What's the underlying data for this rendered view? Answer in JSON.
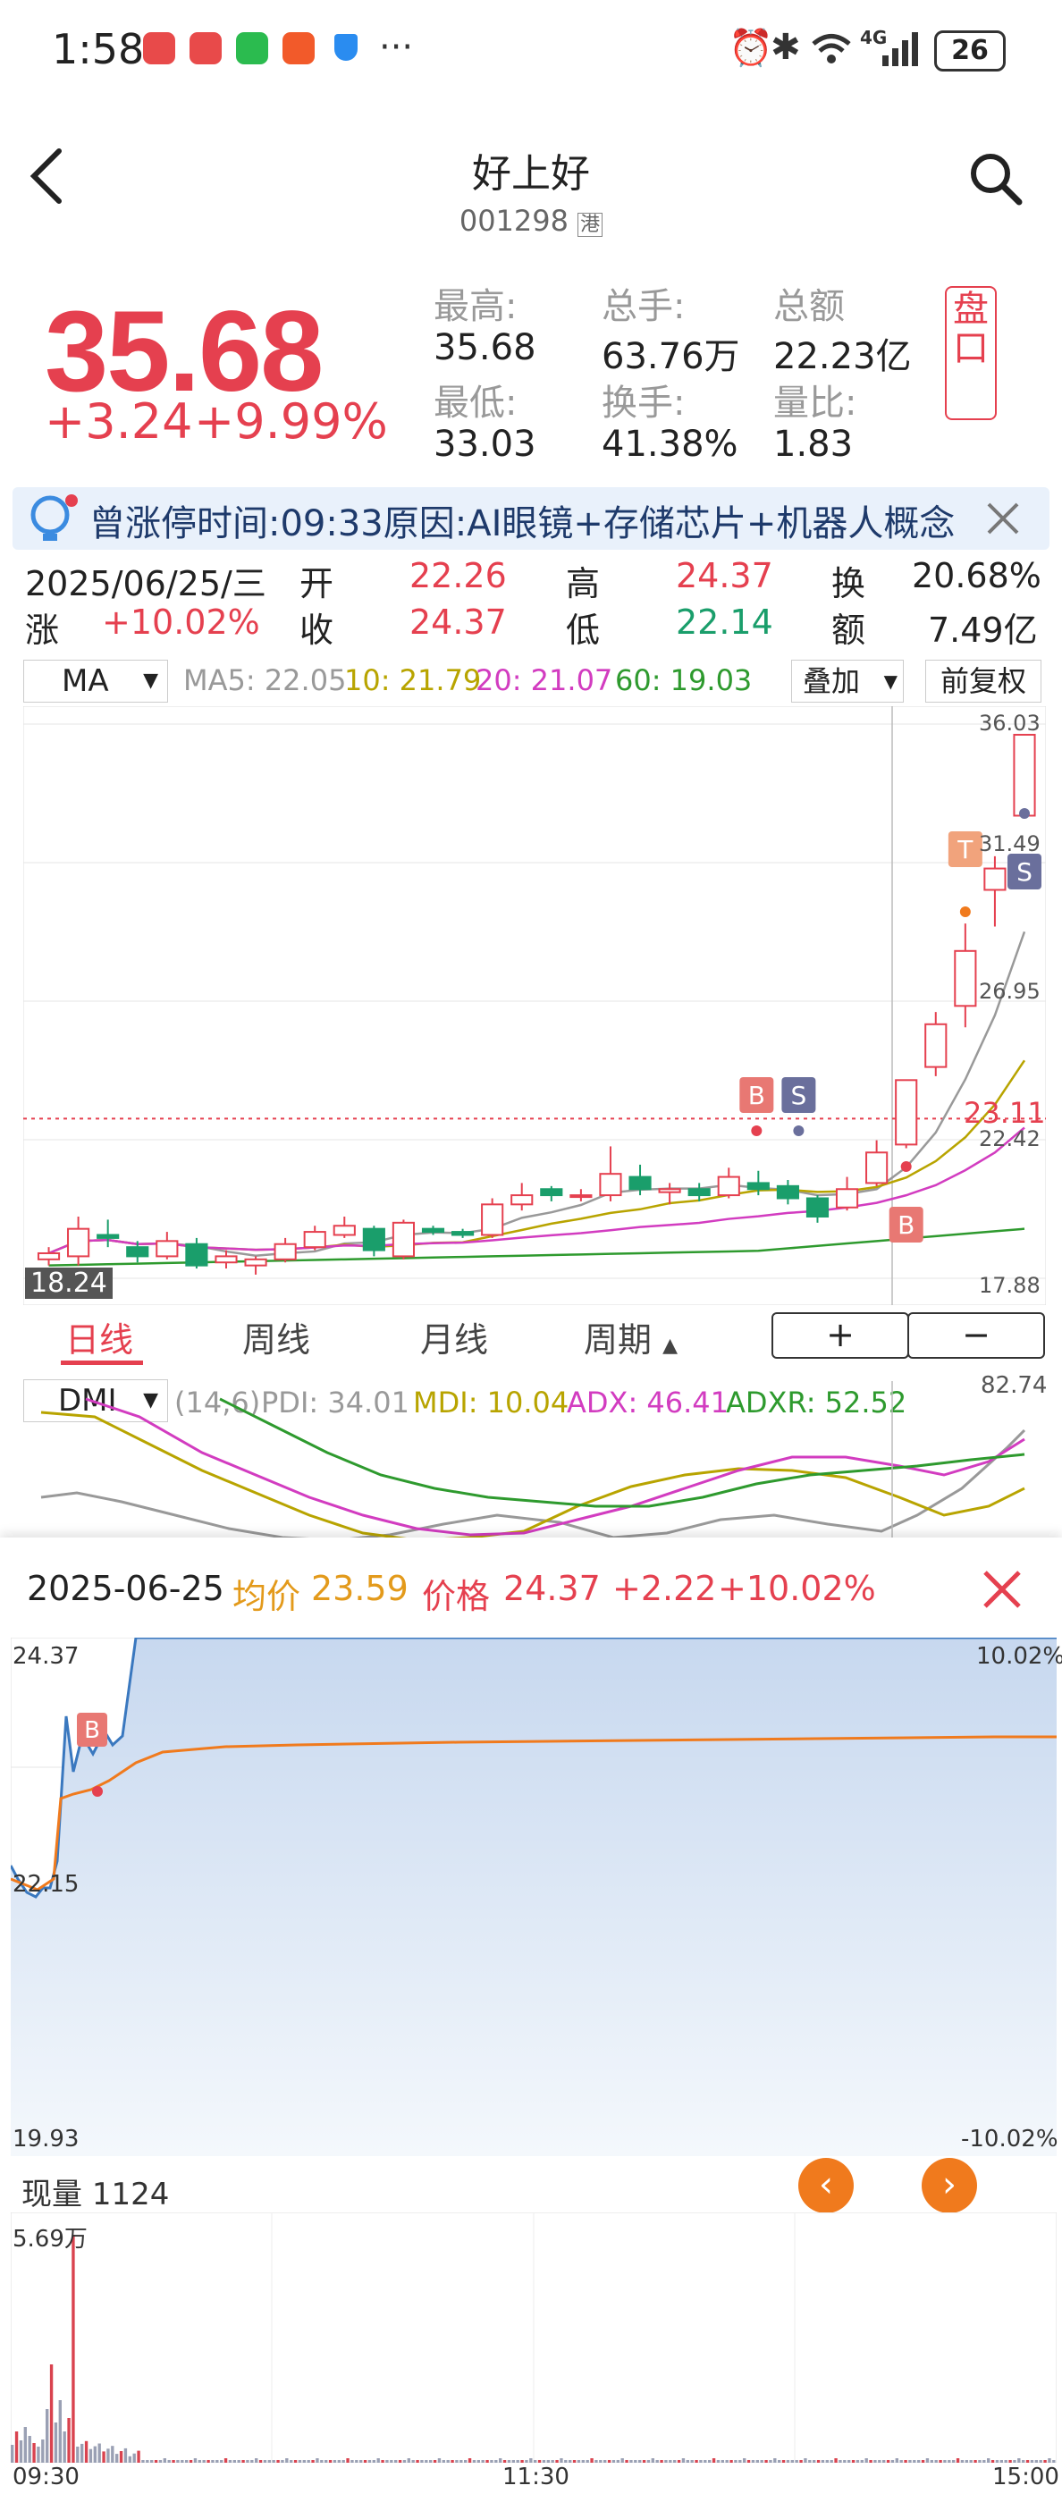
{
  "status_bar": {
    "time": "1:58",
    "network": "4G",
    "battery": "26"
  },
  "nav": {
    "title": "好上好",
    "code": "001298",
    "market_badge": "港"
  },
  "quote": {
    "price": "35.68",
    "change": "+3.24",
    "change_pct": "+9.99%",
    "stats": [
      {
        "label": "最高:",
        "value": "35.68"
      },
      {
        "label": "总手:",
        "value": "63.76万"
      },
      {
        "label": "总额",
        "value": "22.23亿"
      },
      {
        "label": "最低:",
        "value": "33.03"
      },
      {
        "label": "换手:",
        "value": "41.38%"
      },
      {
        "label": "量比:",
        "value": "1.83"
      }
    ],
    "pankou_button": "盘口"
  },
  "news": {
    "text": "曾涨停时间:09:33原因:AI眼镜+存储芯片+机器人概念"
  },
  "day_info": {
    "date": "2025/06/25/三",
    "open_label": "开",
    "open": "22.26",
    "high_label": "高",
    "high": "24.37",
    "turnover_label": "换",
    "turnover": "20.68%",
    "change_label": "涨",
    "change_pct": "+10.02%",
    "close_label": "收",
    "close": "24.37",
    "low_label": "低",
    "low": "22.14",
    "amount_label": "额",
    "amount": "7.49亿"
  },
  "kline": {
    "indicator_select": "MA",
    "ma_legend": [
      {
        "label": "MA5: 22.05",
        "color": "#999999"
      },
      {
        "label": "10: 21.79",
        "color": "#b8a400"
      },
      {
        "label": "20: 21.07",
        "color": "#d23cc0"
      },
      {
        "label": "60: 19.03",
        "color": "#2e9a2e"
      }
    ],
    "overlay_button": "叠加",
    "adjust_button": "前复权",
    "y_labels": [
      "36.03",
      "31.49",
      "26.95",
      "22.42",
      "17.88"
    ],
    "ref_price": "23.11",
    "low_mark": "18.24",
    "markers": {
      "buy": "B",
      "sell": "S",
      "top": "T"
    },
    "colors": {
      "up": "#e5404f",
      "down": "#1a9e6b"
    }
  },
  "period_tabs": [
    "日线",
    "周线",
    "月线",
    "周期"
  ],
  "zoom_in": "+",
  "zoom_out": "−",
  "dmi": {
    "select": "DMI",
    "params": "(14,6)",
    "legend": [
      {
        "label": "PDI: 34.01",
        "color": "#999999"
      },
      {
        "label": "MDI: 10.04",
        "color": "#b8a400"
      },
      {
        "label": "ADX: 46.41",
        "color": "#d23cc0"
      },
      {
        "label": "ADXR: 52.52",
        "color": "#2e9a2e"
      }
    ],
    "top_value": "82.74"
  },
  "intraday": {
    "date": "2025-06-25",
    "avg_label": "均价",
    "avg_value": "23.59",
    "price_label": "价格",
    "price_value": "24.37",
    "change": "+2.22",
    "change_pct": "+10.02%",
    "y_top": "24.37",
    "y_pct_top": "10.02%",
    "y_mid": "22.15",
    "y_bottom": "19.93",
    "y_pct_bottom": "-10.02%",
    "buy_marker": "B",
    "volume_label": "现量",
    "volume_value": "1124",
    "vol_max": "5.69万",
    "time_labels": [
      "09:30",
      "11:30",
      "15:00"
    ]
  }
}
